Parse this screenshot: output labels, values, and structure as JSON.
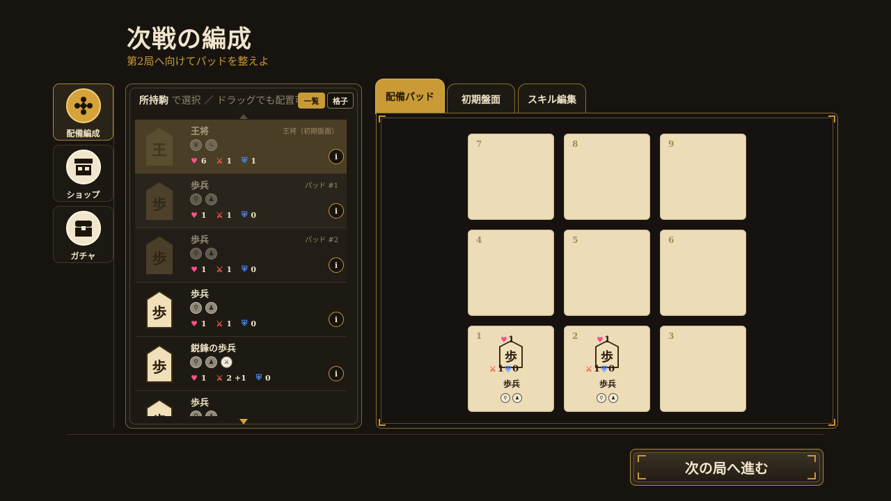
{
  "header": {
    "title": "次戦の編成",
    "subtitle": "第2局へ向けてパッドを整えよ"
  },
  "nav": [
    {
      "label": "配備編成",
      "icon": "formation-icon",
      "active": true
    },
    {
      "label": "ショップ",
      "icon": "shop-icon",
      "active": false
    },
    {
      "label": "ガチャ",
      "icon": "gacha-chest-icon",
      "active": false
    }
  ],
  "inventory": {
    "title": "所持駒",
    "hint": "で選択 ／ ドラッグでも配置可",
    "view_list": "一覧",
    "view_grid": "格子",
    "items": [
      {
        "name": "王将",
        "glyph": "王",
        "tag": "王将（初期盤面）",
        "hp": "6",
        "atk": "1",
        "def": "1",
        "skills": [
          "crown-skill-icon",
          "swirl-skill-icon"
        ],
        "selected": true
      },
      {
        "name": "歩兵",
        "glyph": "歩",
        "tag": "パッド #1",
        "hp": "1",
        "atk": "1",
        "def": "0",
        "skills": [
          "pin-skill-icon",
          "pawn-skill-icon"
        ],
        "dimmed": true
      },
      {
        "name": "歩兵",
        "glyph": "歩",
        "tag": "パッド #2",
        "hp": "1",
        "atk": "1",
        "def": "0",
        "skills": [
          "pin-skill-icon",
          "pawn-skill-icon"
        ],
        "dimmed": true
      },
      {
        "name": "歩兵",
        "glyph": "歩",
        "tag": "",
        "hp": "1",
        "atk": "1",
        "def": "0",
        "skills": [
          "pin-skill-icon",
          "pawn-skill-icon"
        ]
      },
      {
        "name": "鋭鋒の歩兵",
        "glyph": "歩",
        "tag": "",
        "hp": "1",
        "atk": "2 +1",
        "def": "0",
        "skills": [
          "pin-skill-icon",
          "pawn-skill-icon",
          "swords-skill-icon"
        ]
      },
      {
        "name": "歩兵",
        "glyph": "歩",
        "tag": "",
        "hp": "",
        "atk": "",
        "def": "",
        "skills": [
          "pin-skill-icon",
          "pawn-skill-icon"
        ]
      }
    ]
  },
  "tabs": [
    "配備パッド",
    "初期盤面",
    "スキル編集"
  ],
  "board": {
    "cells": [
      {
        "n": "7"
      },
      {
        "n": "8"
      },
      {
        "n": "9"
      },
      {
        "n": "4"
      },
      {
        "n": "5"
      },
      {
        "n": "6"
      },
      {
        "n": "1",
        "piece": {
          "glyph": "歩",
          "name": "歩兵",
          "hp": "1",
          "atk": "1",
          "def": "0"
        }
      },
      {
        "n": "2",
        "piece": {
          "glyph": "歩",
          "name": "歩兵",
          "hp": "1",
          "atk": "1",
          "def": "0"
        }
      },
      {
        "n": "3"
      }
    ]
  },
  "next_button": "次の局へ進む",
  "colors": {
    "accent": "#c99a36",
    "bg": "#171410",
    "card": "#ecdcb7"
  }
}
